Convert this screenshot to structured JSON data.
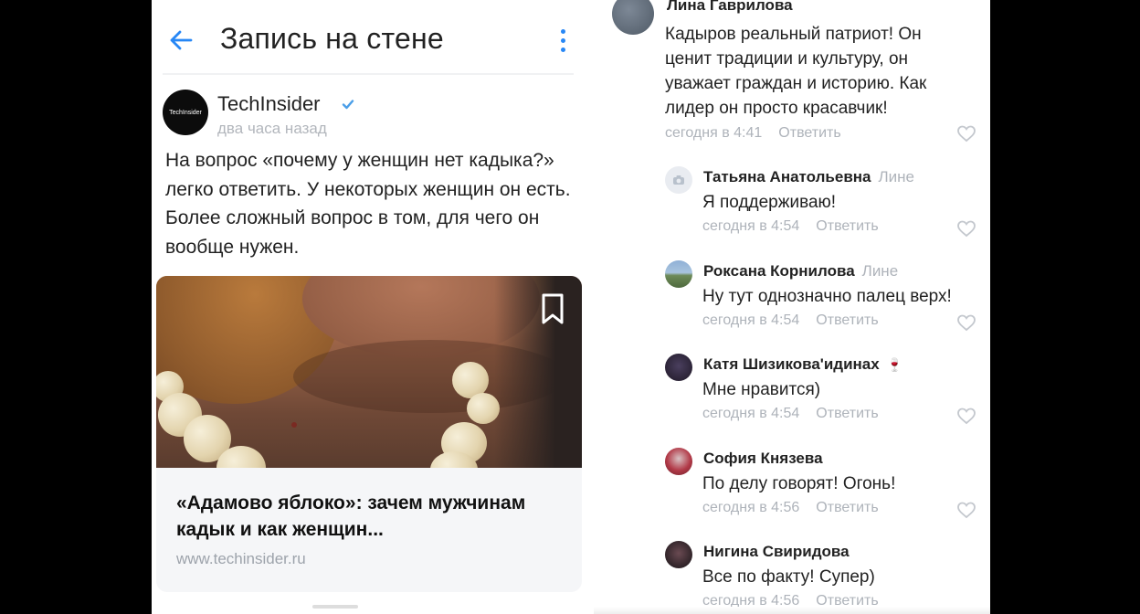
{
  "post": {
    "title": "Запись на стене",
    "author": "TechInsider",
    "author_avatar_text": "TechInsider",
    "time": "два часа назад",
    "text": "На вопрос «почему у женщин нет кадыка?» легко ответить. У некоторых женщин он есть. Более сложный вопрос в том, для чего он вообще нужен.",
    "link_title": "«Адамово яблоко»: зачем мужчинам кадык и как женщин...",
    "link_domain": "www.techinsider.ru"
  },
  "comments": {
    "top": {
      "author": "Лина Гаврилова",
      "text": "Кадыров реальный патриот! Он ценит традиции и культуру, он уважает граждан и историю. Как лидер он просто красавчик!",
      "time": "сегодня в 4:41",
      "reply_label": "Ответить"
    },
    "replies": [
      {
        "author": "Татьяна Анатольевна",
        "reply_to": "Лине",
        "text": "Я поддерживаю!",
        "time": "сегодня в 4:54",
        "reply_label": "Ответить"
      },
      {
        "author": "Роксана Корнилова",
        "reply_to": "Лине",
        "text": "Ну тут однозначно палец верх!",
        "time": "сегодня в 4:54",
        "reply_label": "Ответить"
      },
      {
        "author": "Катя Шизикова'идинах",
        "text": "Мне нравится)",
        "time": "сегодня в 4:54",
        "reply_label": "Ответить"
      },
      {
        "author": "София Князева",
        "text": "По делу говорят! Огонь!",
        "time": "сегодня в 4:56",
        "reply_label": "Ответить"
      },
      {
        "author": "Нигина Свиридова",
        "text": "Все по факту! Супер)",
        "time": "сегодня в 4:56",
        "reply_label": "Ответить"
      }
    ]
  },
  "colors": {
    "accent": "#2787f5",
    "secondary_text": "#aeb3ba",
    "primary_text": "#222222"
  }
}
